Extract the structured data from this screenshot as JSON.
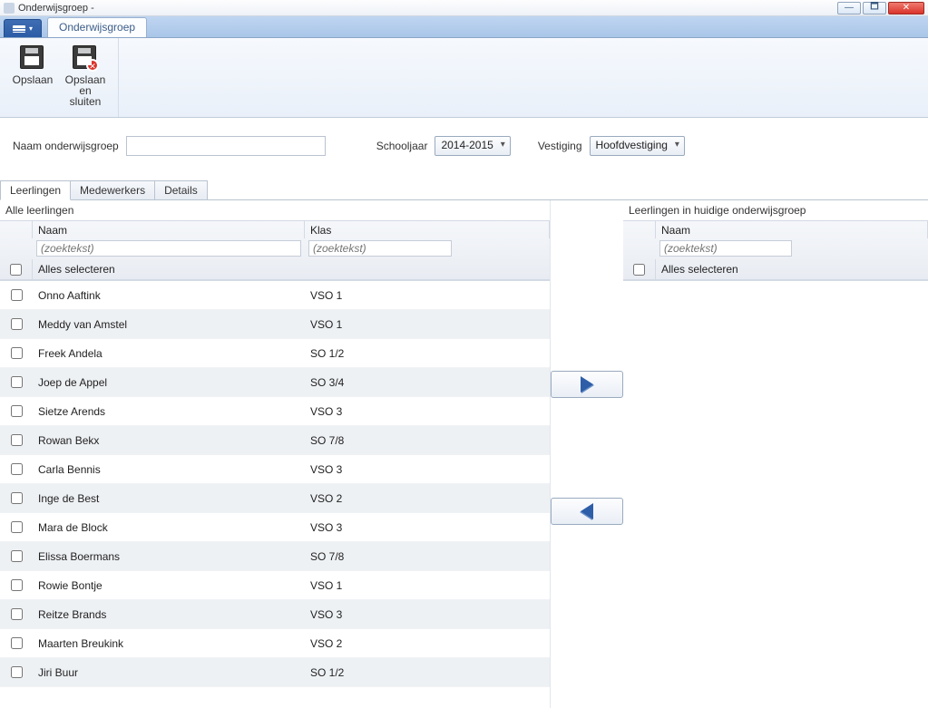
{
  "window": {
    "title": "Onderwijsgroep -"
  },
  "ribbon": {
    "tab_label": "Onderwijsgroep",
    "save_label": "Opslaan",
    "save_close_label": "Opslaan en sluiten"
  },
  "form": {
    "name_label": "Naam onderwijsgroep",
    "name_value": "",
    "schoolyear_label": "Schooljaar",
    "schoolyear_value": "2014-2015",
    "location_label": "Vestiging",
    "location_value": "Hoofdvestiging"
  },
  "tabs": {
    "students": "Leerlingen",
    "staff": "Medewerkers",
    "details": "Details"
  },
  "left": {
    "title": "Alle leerlingen",
    "col_name": "Naam",
    "col_klas": "Klas",
    "search_placeholder": "(zoektekst)",
    "select_all": "Alles selecteren",
    "rows": [
      {
        "name": "Onno Aaftink",
        "klas": "VSO 1"
      },
      {
        "name": "Meddy van Amstel",
        "klas": "VSO 1"
      },
      {
        "name": "Freek Andela",
        "klas": "SO 1/2"
      },
      {
        "name": "Joep de Appel",
        "klas": "SO 3/4"
      },
      {
        "name": "Sietze Arends",
        "klas": "VSO 3"
      },
      {
        "name": "Rowan Bekx",
        "klas": "SO 7/8"
      },
      {
        "name": "Carla Bennis",
        "klas": "VSO 3"
      },
      {
        "name": "Inge de Best",
        "klas": "VSO 2"
      },
      {
        "name": "Mara de Block",
        "klas": "VSO 3"
      },
      {
        "name": "Elissa Boermans",
        "klas": "SO 7/8"
      },
      {
        "name": "Rowie Bontje",
        "klas": "VSO 1"
      },
      {
        "name": "Reitze Brands",
        "klas": "VSO 3"
      },
      {
        "name": "Maarten Breukink",
        "klas": "VSO 2"
      },
      {
        "name": "Jiri Buur",
        "klas": "SO 1/2"
      }
    ]
  },
  "right": {
    "title": "Leerlingen in huidige onderwijsgroep",
    "col_name": "Naam",
    "search_placeholder": "(zoektekst)",
    "select_all": "Alles selecteren"
  }
}
